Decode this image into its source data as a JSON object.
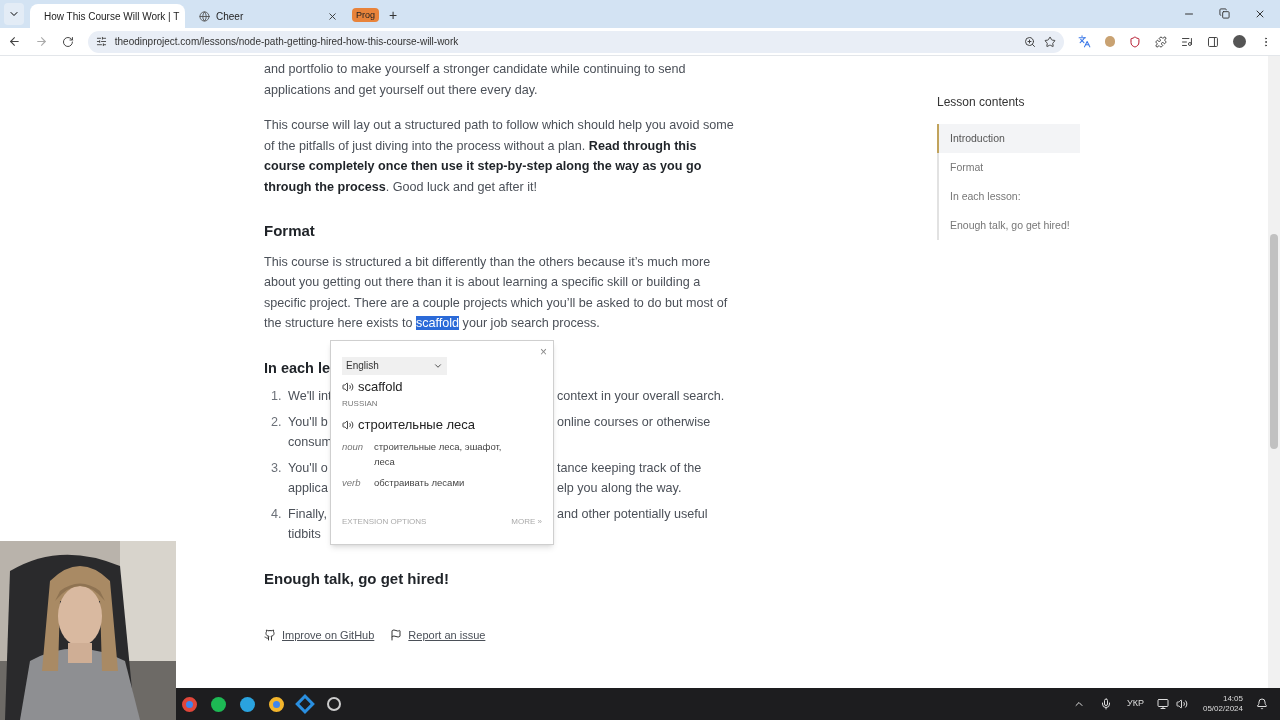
{
  "browser": {
    "tabs": [
      {
        "title": "How This Course Will Work | T",
        "selected": true
      },
      {
        "title": "Cheer",
        "selected": false
      }
    ],
    "tab_group": {
      "label": "Prog",
      "color": "#e8833a"
    },
    "new_tab": "+",
    "url": "theodinproject.com/lessons/node-path-getting-hired-how-this-course-will-work"
  },
  "article": {
    "paragraph_1": "and portfolio to make yourself a stronger candidate while continuing to send applications and get yourself out there every day.",
    "paragraph_2": "This course will lay out a structured path to follow which should help you avoid some of the pitfalls of just diving into the process without a plan. **Read through this course completely once then use it step-by-step along the way as you go through the process**. Good luck and get after it!",
    "heading_format": "Format",
    "paragraph_3": {
      "before": "This course is structured a bit differently than the others because it’s much more about you getting out there than it is about learning a specific skill or building a specific project. There are a couple projects which you’ll be asked to do but most of the structure here exists to ",
      "highlighted": "scaffold",
      "after": " your job search process."
    },
    "heading_lesson": "In each le",
    "list": [
      {
        "number": "1.",
        "lines": [
          {
            "left": "We'll int",
            "right": "context in your overall search."
          }
        ]
      },
      {
        "number": "2.",
        "lines": [
          {
            "left": "You'll b",
            "right": "online courses or otherwise"
          },
          {
            "left": "consum"
          }
        ]
      },
      {
        "number": "3.",
        "lines": [
          {
            "left": "You'll o",
            "right": "tance keeping track of the"
          },
          {
            "left": "applica",
            "right": "elp you along the way."
          }
        ]
      },
      {
        "number": "4.",
        "lines": [
          {
            "left": "Finally,",
            "right": "and other potentially useful"
          },
          {
            "left": "tidbits"
          }
        ]
      }
    ],
    "heading_hired": "Enough talk, go get hired!",
    "links": [
      "Improve on GitHub",
      "Report an issue"
    ]
  },
  "translate_popup": {
    "close": "×",
    "language": "English",
    "word": "scaffold",
    "target_language": "RUSSIAN",
    "translation": "строительные леса",
    "meanings": [
      {
        "part": "noun",
        "text": "строительные леса, эшафот, леса"
      },
      {
        "part": "verb",
        "text": "обстраивать лесами"
      }
    ],
    "options": "EXTENSION OPTIONS",
    "more": "MORE »"
  },
  "lesson_contents": {
    "title": "Lesson contents",
    "items": [
      {
        "label": "Introduction",
        "selected": true
      },
      {
        "label": "Format",
        "selected": false
      },
      {
        "label": "In each lesson:",
        "selected": false
      },
      {
        "label": "Enough talk, go get hired!",
        "selected": false
      }
    ]
  },
  "taskbar": {
    "language": "УКР",
    "time": "14:05",
    "date": "05/02/2024"
  }
}
